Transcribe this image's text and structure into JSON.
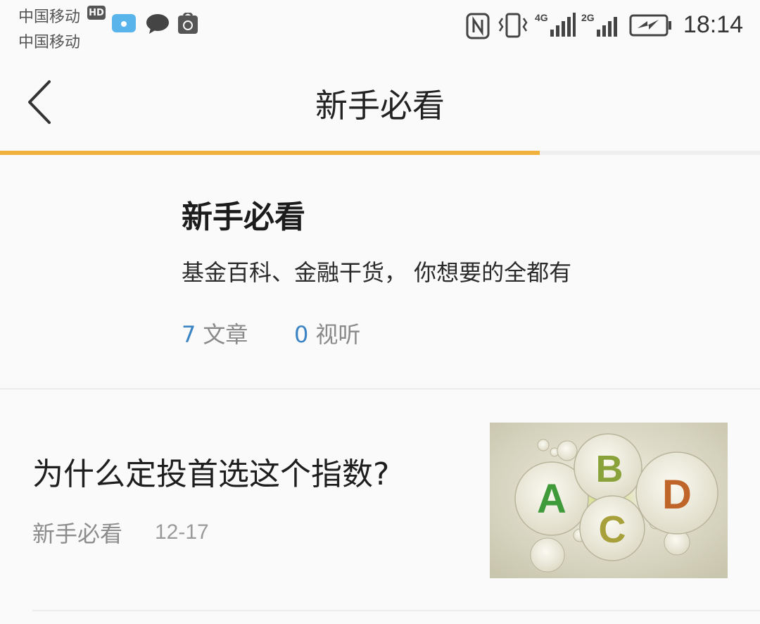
{
  "status_bar": {
    "carrier_1": "中国移动",
    "carrier_2": "中国移动",
    "hd_badge": "HD",
    "time": "18:14",
    "network_1": "4G",
    "network_2": "2G"
  },
  "nav": {
    "title": "新手必看",
    "back_icon": "chevron-left-icon",
    "progress": 0.71
  },
  "intro": {
    "title": "新手必看",
    "description": "基金百科、金融干货， 你想要的全都有",
    "article_count": "7",
    "article_label": "文章",
    "media_count": "0",
    "media_label": "视听"
  },
  "articles": [
    {
      "title": "为什么定投首选这个指数?",
      "source": "新手必看",
      "date": "12-17",
      "thumb_letters": [
        "A",
        "B",
        "C",
        "D"
      ]
    }
  ],
  "colors": {
    "accent": "#f0b03c",
    "count_blue": "#3a84c4",
    "background": "#fafafa"
  }
}
